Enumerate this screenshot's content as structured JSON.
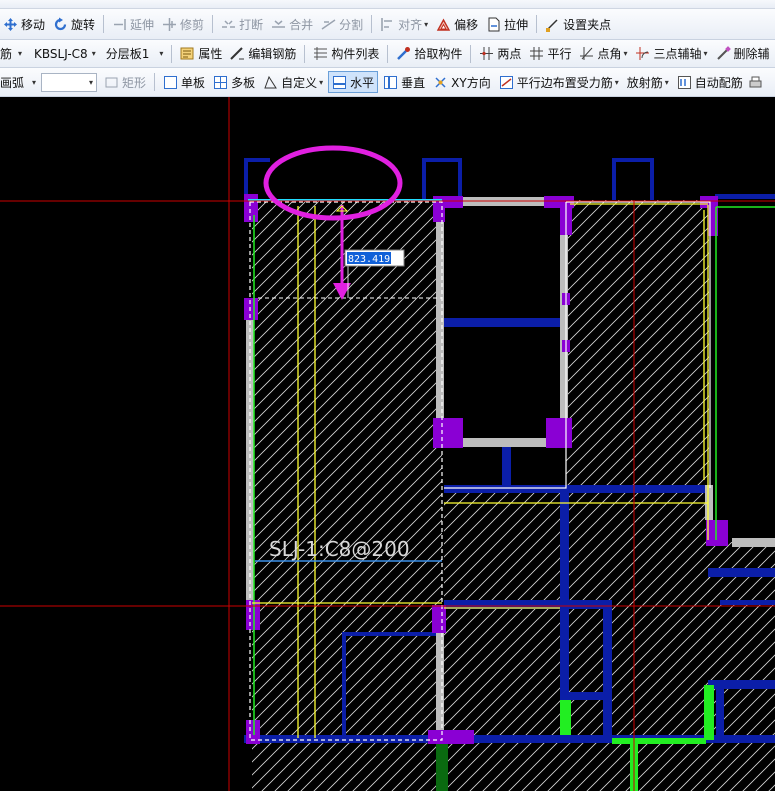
{
  "colors": {
    "canvas_bg": "#000000",
    "slab_hatch": "#d8d8d8",
    "beam_blue": "#0b1ea8",
    "column_purple": "#8a00d4",
    "annotation_magenta": "#e020e0",
    "rebar_yellow": "#ffff33",
    "axis_red": "#cc0000",
    "wall_green": "#22ee22",
    "selected_cyan": "#22ddff"
  },
  "toolbar1": {
    "move": "移动",
    "rotate": "旋转",
    "extend": "延伸",
    "trim": "修剪",
    "break": "打断",
    "merge": "合并",
    "split": "分割",
    "align": "对齐",
    "offset": "偏移",
    "stretch": "拉伸",
    "set_grip": "设置夹点"
  },
  "toolbar2": {
    "category_tail": "筋",
    "component_combo": "KBSLJ-C8",
    "layer_combo": "分层板1",
    "properties": "属性",
    "edit_rebar": "编辑钢筋",
    "component_list": "构件列表",
    "pick_component": "拾取构件",
    "two_points": "两点",
    "parallel": "平行",
    "point_angle": "点角",
    "three_point_axis": "三点辅轴",
    "delete_aux": "删除辅"
  },
  "toolbar3": {
    "arc_tail": "画弧",
    "rect": "矩形",
    "single_slab": "单板",
    "multi_slab": "多板",
    "custom": "自定义",
    "horizontal": "水平",
    "vertical": "垂直",
    "xy_direction": "XY方向",
    "parallel_edge": "平行边布置受力筋",
    "radial": "放射筋",
    "auto_rebar": "自动配筋"
  },
  "cad": {
    "rebar_label": "SLJ-1:C8@200",
    "dimension_value": "823.419"
  }
}
